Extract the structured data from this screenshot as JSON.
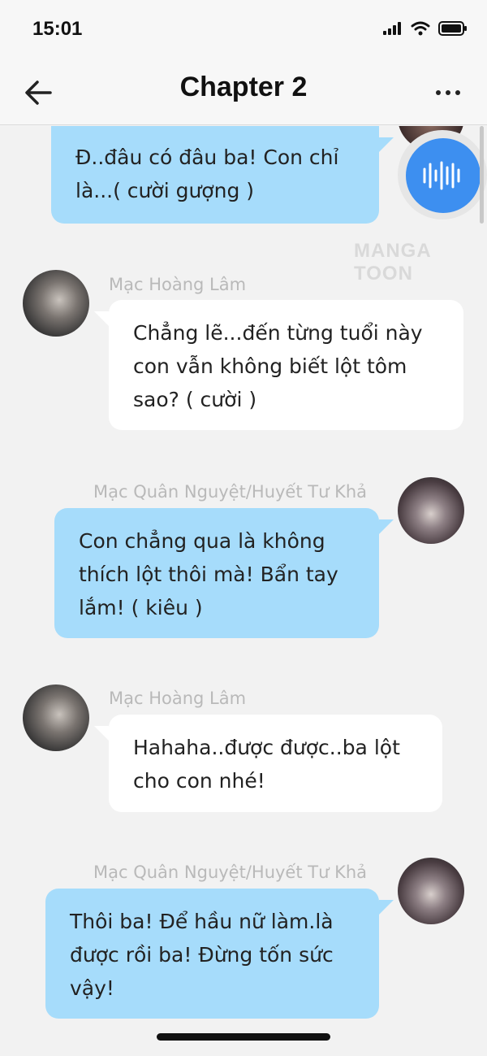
{
  "status_bar": {
    "time": "15:01"
  },
  "nav": {
    "title": "Chapter 2"
  },
  "watermark": "MANGA TOON",
  "messages": [
    {
      "text": "Đ..đâu có đâu ba! Con chỉ là...( cười gượng )"
    },
    {
      "sender": "Mạc Hoàng Lâm",
      "text": "Chẳng lẽ...đến từng tuổi này con vẫn không biết lột tôm sao? ( cười )"
    },
    {
      "sender": "Mạc Quân Nguyệt/Huyết Tư Khả",
      "text": "Con chẳng qua là không thích lột thôi mà! Bẩn tay lắm! ( kiêu )"
    },
    {
      "sender": "Mạc Hoàng Lâm",
      "text": "Hahaha..được được..ba lột cho con nhé!"
    },
    {
      "sender": "Mạc Quân Nguyệt/Huyết Tư Khả",
      "text": "Thôi ba! Để hầu nữ làm.là được rồi ba! Đừng tốn sức vậy!"
    }
  ],
  "colors": {
    "bubble_self": "#a6dcfb",
    "bubble_other": "#ffffff",
    "voice_button": "#3d8ff0",
    "background": "#f2f2f2"
  },
  "icons": [
    "back-arrow-icon",
    "more-icon",
    "voice-wave-icon",
    "signal-icon",
    "wifi-icon",
    "battery-icon"
  ]
}
